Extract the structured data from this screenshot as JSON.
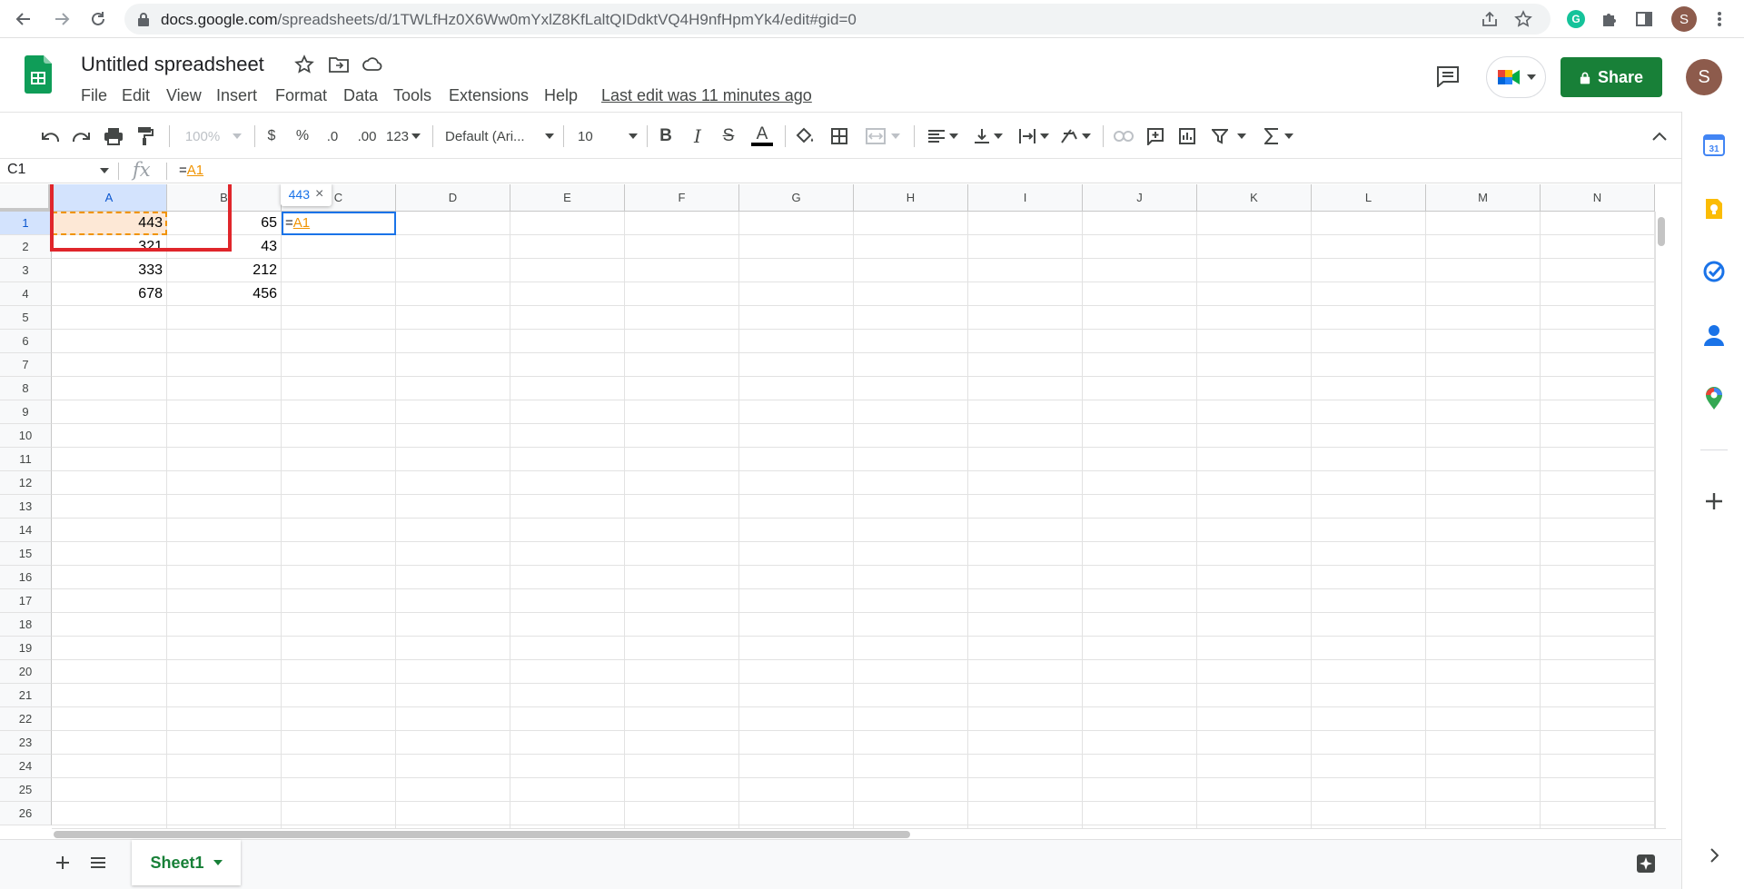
{
  "browser": {
    "url_host": "docs.google.com",
    "url_path": "/spreadsheets/d/1TWLfHz0X6Ww0mYxlZ8KfLaltQIDdktVQ4H9nfHpmYk4/edit#gid=0",
    "profile_initial": "S"
  },
  "app": {
    "title": "Untitled spreadsheet",
    "menu": [
      "File",
      "Edit",
      "View",
      "Insert",
      "Format",
      "Data",
      "Tools",
      "Extensions",
      "Help"
    ],
    "last_edit": "Last edit was 11 minutes ago",
    "share_label": "Share",
    "avatar_initial": "S"
  },
  "toolbar": {
    "zoom": "100%",
    "currency": "$",
    "percent": "%",
    "decrease_decimal": ".0",
    "increase_decimal": ".00",
    "number_format": "123",
    "font": "Default (Ari...",
    "font_size": "10",
    "bold": "B",
    "italic": "I",
    "strike": "S",
    "text_color": "A"
  },
  "formula_bar": {
    "name_box": "C1",
    "fx": "fx",
    "formula_prefix": "=",
    "formula_ref": "A1"
  },
  "grid": {
    "columns": [
      "A",
      "B",
      "C",
      "D",
      "E",
      "F",
      "G",
      "H",
      "I",
      "J",
      "K",
      "L",
      "M",
      "N"
    ],
    "rows": [
      "1",
      "2",
      "3",
      "4",
      "5",
      "6",
      "7",
      "8",
      "9",
      "10",
      "11",
      "12",
      "13",
      "14",
      "15",
      "16",
      "17",
      "18",
      "19",
      "20",
      "21",
      "22",
      "23",
      "24",
      "25",
      "26"
    ],
    "cells": [
      [
        "443",
        "65"
      ],
      [
        "321",
        "43"
      ],
      [
        "333",
        "212"
      ],
      [
        "678",
        "456"
      ]
    ],
    "editing_cell": {
      "prefix": "=",
      "ref": "A1"
    },
    "tooltip_value": "443",
    "tooltip_close": "×"
  },
  "bottom": {
    "sheet_tab": "Sheet1"
  },
  "colors": {
    "accent_green": "#188038",
    "selection_blue": "#1a73e8",
    "reference_orange": "#f09300",
    "highlight_red": "#e0262b"
  }
}
